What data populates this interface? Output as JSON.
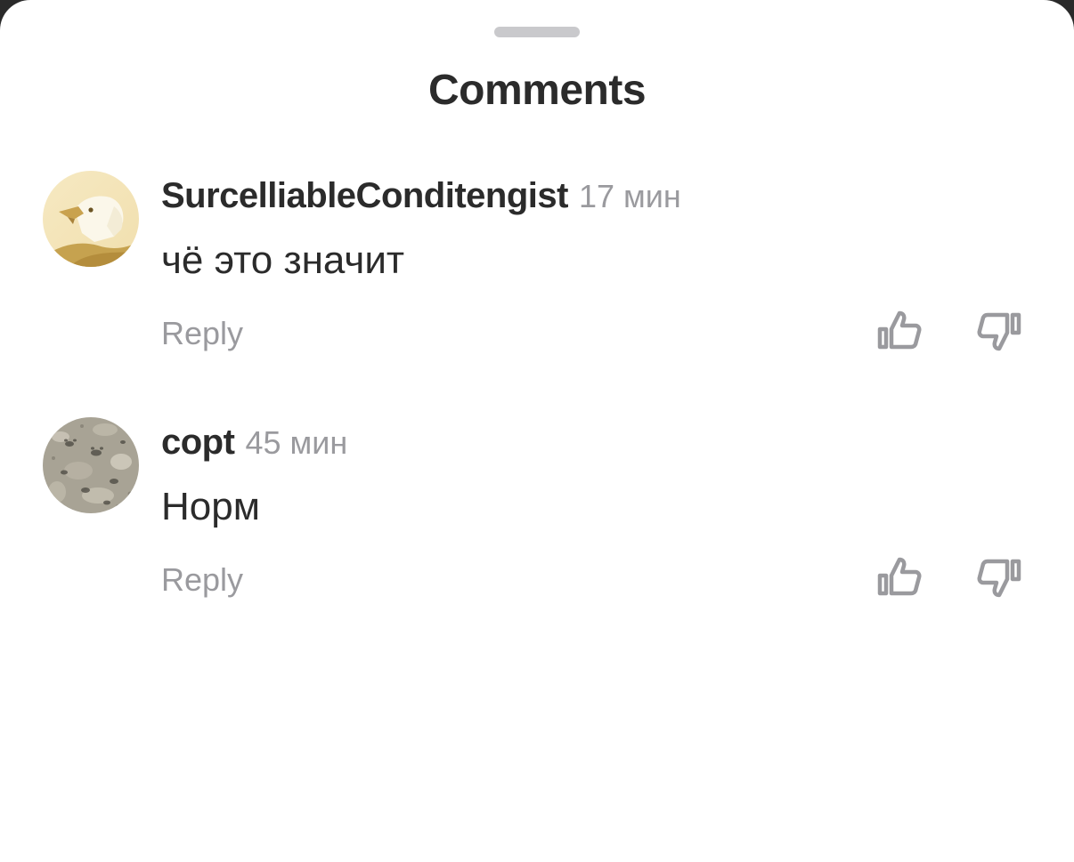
{
  "sheet": {
    "title": "Comments"
  },
  "comments": [
    {
      "username": "SurcelliableConditengist",
      "time": "17 мин",
      "text": "чё это значит",
      "reply_label": "Reply",
      "avatar": "eagle-logo-avatar"
    },
    {
      "username": "copt",
      "time": "45 мин",
      "text": "Норм",
      "reply_label": "Reply",
      "avatar": "sand-footprints-avatar"
    }
  ],
  "colors": {
    "text_primary": "#2b2b2b",
    "text_secondary": "#9a9a9e",
    "icon": "#9a9a9e",
    "grabber": "#c9c9cc"
  }
}
